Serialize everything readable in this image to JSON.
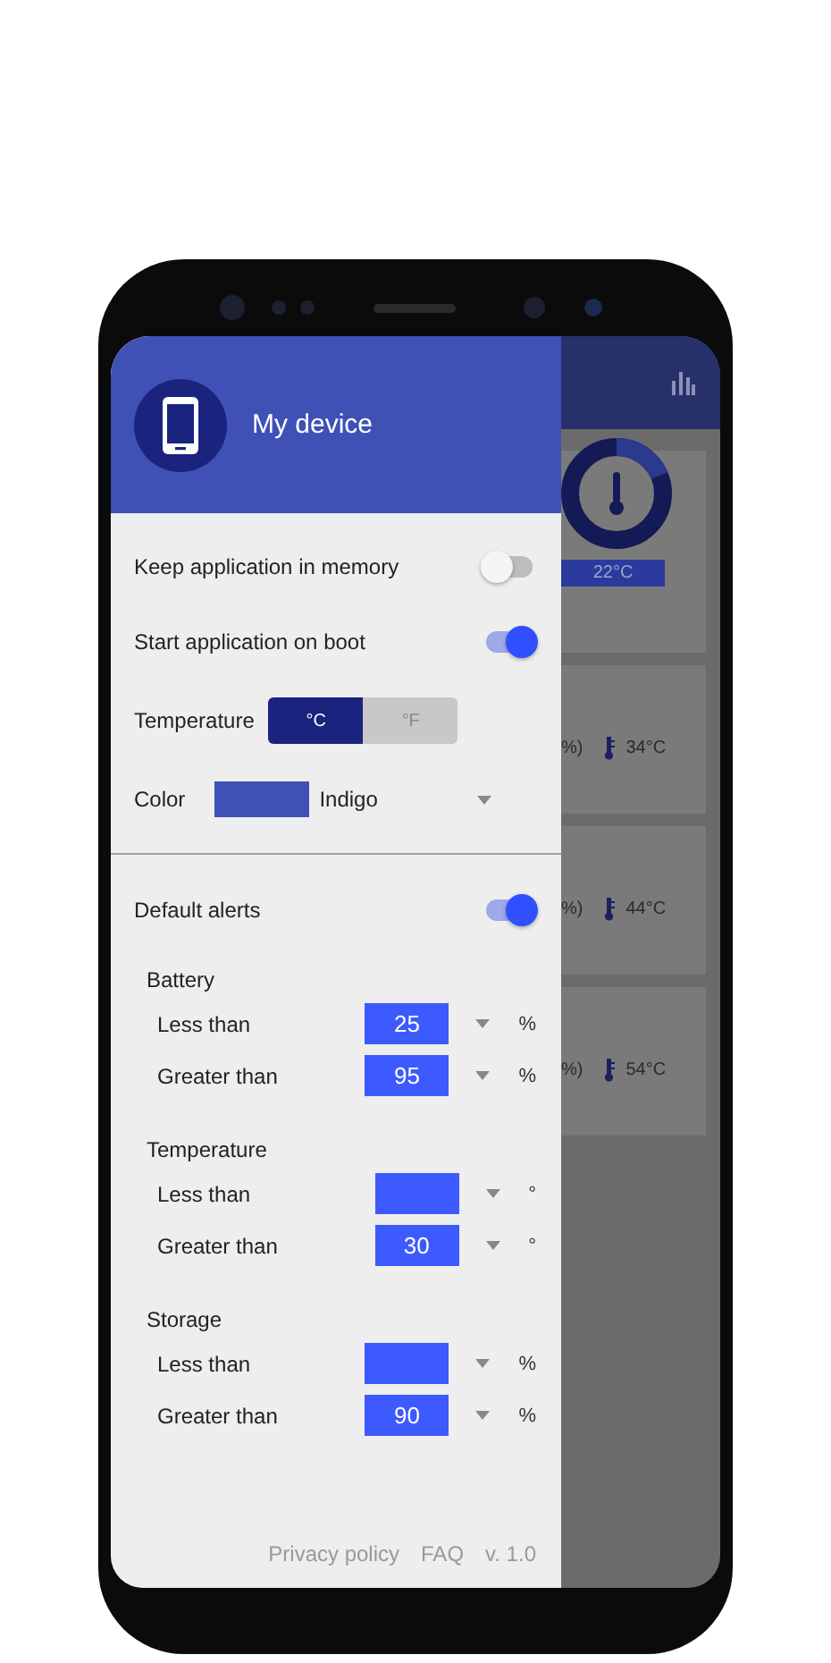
{
  "drawer": {
    "header": {
      "title": "My device"
    },
    "settings": [
      {
        "kind": "toggle",
        "label": "Keep application in memory",
        "on": false
      },
      {
        "kind": "toggle",
        "label": "Start application on boot",
        "on": true
      },
      {
        "kind": "segmented",
        "label": "Temperature",
        "options": [
          {
            "label": "°C",
            "selected": true
          },
          {
            "label": "°F",
            "selected": false
          }
        ]
      },
      {
        "kind": "dropdown",
        "label": "Color",
        "value": "Indigo",
        "color": "#3f51b5"
      }
    ],
    "alerts": {
      "label": "Default alerts",
      "on": true,
      "groups": [
        {
          "title": "Battery",
          "rows": [
            {
              "label": "Less than",
              "value": "25",
              "unit": "%"
            },
            {
              "label": "Greater than",
              "value": "95",
              "unit": "%"
            }
          ]
        },
        {
          "title": "Temperature",
          "rows": [
            {
              "label": "Less than",
              "unit": "°"
            },
            {
              "label": "Greater than",
              "value": "30",
              "unit": "°"
            }
          ]
        },
        {
          "title": "Storage",
          "rows": [
            {
              "label": "Less than",
              "unit": "%"
            },
            {
              "label": "Greater than",
              "value": "90",
              "unit": "%"
            }
          ]
        }
      ]
    },
    "footer": [
      "Privacy policy",
      "FAQ",
      "v. 1.0"
    ]
  },
  "background": {
    "gauge_reading": "22°C",
    "cards": [
      {
        "text_1": "%)",
        "temperature": "34°C"
      },
      {
        "text_1": "%)",
        "temperature": "44°C"
      },
      {
        "text_1": "%)",
        "temperature": "54°C"
      }
    ]
  }
}
